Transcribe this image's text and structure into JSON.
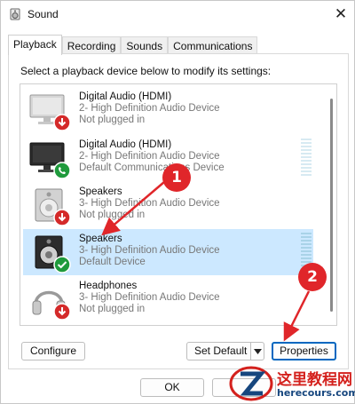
{
  "window": {
    "title": "Sound",
    "close_glyph": "✕"
  },
  "tabs": [
    {
      "label": "Playback",
      "active": true
    },
    {
      "label": "Recording",
      "active": false
    },
    {
      "label": "Sounds",
      "active": false
    },
    {
      "label": "Communications",
      "active": false
    }
  ],
  "instructions": "Select a playback device below to modify its settings:",
  "devices": [
    {
      "name": "Digital Audio (HDMI)",
      "line2": "2- High Definition Audio Device",
      "line3": "Not plugged in",
      "icon": "monitor-icon",
      "status": "unplugged-badge-icon"
    },
    {
      "name": "Digital Audio (HDMI)",
      "line2": "2- High Definition Audio Device",
      "line3": "Default Communications Device",
      "icon": "monitor-icon",
      "status": "phone-badge-icon"
    },
    {
      "name": "Speakers",
      "line2": "3- High Definition Audio Device",
      "line3": "Not plugged in",
      "icon": "speaker-icon",
      "status": "unplugged-badge-icon"
    },
    {
      "name": "Speakers",
      "line2": "3- High Definition Audio Device",
      "line3": "Default Device",
      "icon": "speaker-icon",
      "status": "check-badge-icon",
      "selected": true
    },
    {
      "name": "Headphones",
      "line2": "3- High Definition Audio Device",
      "line3": "Not plugged in",
      "icon": "headphones-icon",
      "status": "unplugged-badge-icon"
    }
  ],
  "buttons": {
    "configure": "Configure",
    "set_default": "Set Default",
    "properties": "Properties",
    "ok": "OK"
  },
  "markers": [
    "1",
    "2"
  ],
  "colors": {
    "accent": "#0067c0",
    "selection": "#cce8ff",
    "marker_red": "#e0262a",
    "badge_red": "#d42a2a",
    "badge_green": "#1f9a3c"
  },
  "watermark": {
    "chinese": "这里教程网",
    "site": "herecours.com"
  }
}
